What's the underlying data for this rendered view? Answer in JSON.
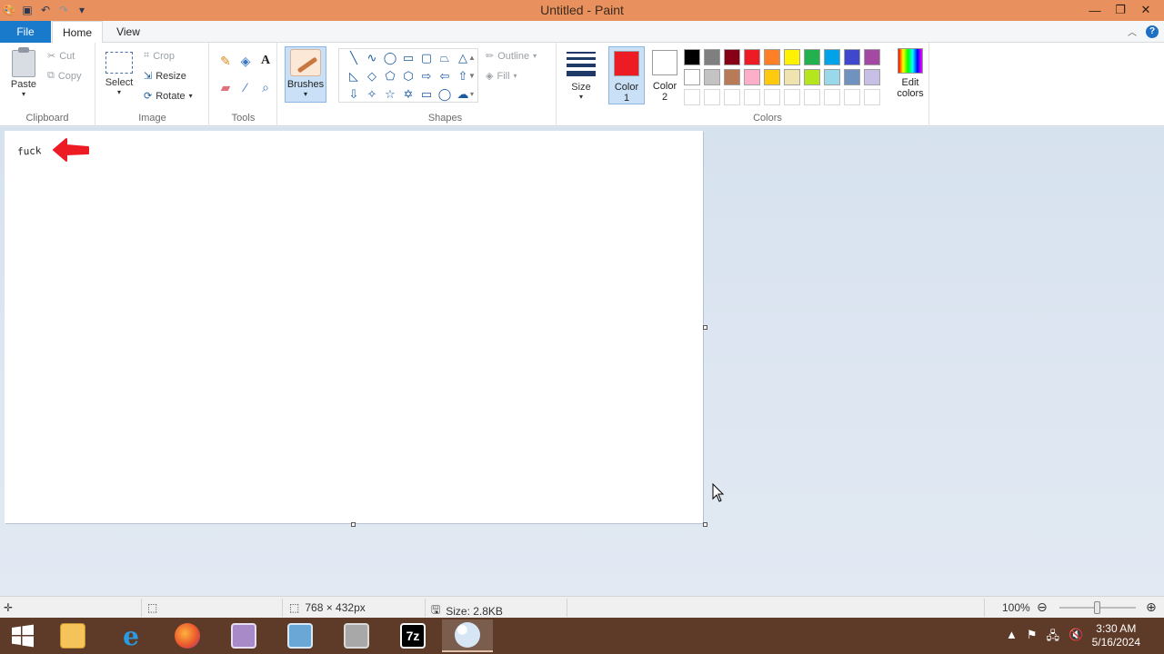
{
  "window": {
    "title": "Untitled - Paint",
    "minimize_icon": "minimize-icon",
    "restore_icon": "restore-icon",
    "close_icon": "close-icon"
  },
  "quick_access": [
    "paint-app-icon",
    "save-icon",
    "undo-icon",
    "redo-icon",
    "customize-dropdown-icon"
  ],
  "tabs": {
    "file": "File",
    "home": "Home",
    "view": "View"
  },
  "ribbon": {
    "clipboard": {
      "label": "Clipboard",
      "paste": "Paste",
      "cut": "Cut",
      "copy": "Copy"
    },
    "image": {
      "label": "Image",
      "select": "Select",
      "crop": "Crop",
      "resize": "Resize",
      "rotate": "Rotate"
    },
    "tools": {
      "label": "Tools",
      "icons": [
        "pencil-icon",
        "fill-bucket-icon",
        "text-icon",
        "eraser-icon",
        "color-picker-icon",
        "magnifier-icon"
      ]
    },
    "brushes": {
      "label": "Brushes"
    },
    "shapes": {
      "label": "Shapes",
      "outline": "Outline",
      "fill": "Fill"
    },
    "size": {
      "label": "Size"
    },
    "colors": {
      "label": "Colors",
      "color1_line1": "Color",
      "color1_line2": "1",
      "color2_line1": "Color",
      "color2_line2": "2",
      "color1_value": "#ed1c24",
      "color2_value": "#ffffff",
      "edit_line1": "Edit",
      "edit_line2": "colors",
      "palette_row1": [
        "#000000",
        "#7f7f7f",
        "#880015",
        "#ed1c24",
        "#ff7f27",
        "#fff200",
        "#22b14c",
        "#00a2e8",
        "#3f48cc",
        "#a349a4"
      ],
      "palette_row2": [
        "#ffffff",
        "#c3c3c3",
        "#b97a57",
        "#ffaec9",
        "#ffc90e",
        "#efe4b0",
        "#b5e61d",
        "#99d9ea",
        "#7092be",
        "#c8bfe7"
      ]
    }
  },
  "canvas": {
    "text": "fuck",
    "arrow_color": "#ed1c24"
  },
  "status": {
    "canvas_size": "768 × 432px",
    "file_size": "Size: 2.8KB",
    "zoom": "100%"
  },
  "taskbar": {
    "apps": [
      "start-button",
      "file-explorer",
      "internet-explorer",
      "firefox",
      "app-purple",
      "control-panel",
      "archive-tool",
      "7zip",
      "paint"
    ],
    "time": "3:30 AM",
    "date": "5/16/2024"
  }
}
